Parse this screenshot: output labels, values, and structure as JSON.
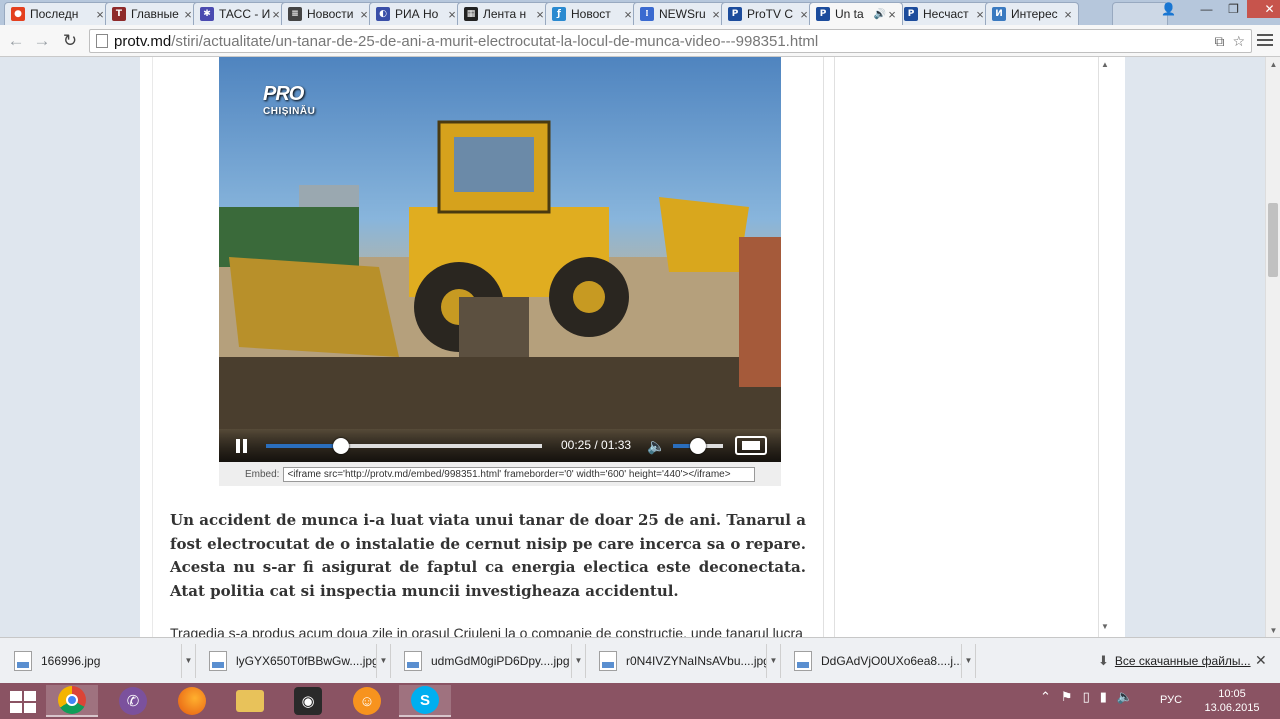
{
  "tabs": [
    {
      "title": "Последн",
      "favicon": "opera-icon",
      "color": "#e4401f",
      "glyph": "●"
    },
    {
      "title": "Главные",
      "favicon": "t-icon",
      "color": "#8e2a2a",
      "glyph": "T"
    },
    {
      "title": "ТАСС - И",
      "favicon": "tass-icon",
      "color": "#4a4ab0",
      "glyph": "✱"
    },
    {
      "title": "Новости",
      "favicon": "document-icon",
      "color": "#444444",
      "glyph": "≡"
    },
    {
      "title": "РИА Но",
      "favicon": "ria-icon",
      "color": "#3a4fa8",
      "glyph": "◐"
    },
    {
      "title": "Лента н",
      "favicon": "lenta-icon",
      "color": "#222222",
      "glyph": "▦"
    },
    {
      "title": "Новост",
      "favicon": "fontanka-icon",
      "color": "#2a8ad0",
      "glyph": "ƒ"
    },
    {
      "title": "NEWSru",
      "favicon": "newsru-icon",
      "color": "#3a6ad0",
      "glyph": "⁞"
    },
    {
      "title": "ProTV C",
      "favicon": "protv-icon",
      "color": "#1c4c9c",
      "glyph": "P"
    },
    {
      "title": "Un ta",
      "favicon": "protv-icon",
      "color": "#1c4c9c",
      "glyph": "P"
    },
    {
      "title": "Несчаст",
      "favicon": "protv-icon",
      "color": "#1c4c9c",
      "glyph": "P"
    },
    {
      "title": "Интерес",
      "favicon": "i-icon",
      "color": "#3a7ac0",
      "glyph": "И"
    }
  ],
  "address_bar": {
    "domain": "protv.md",
    "path": "/stiri/actualitate/un-tanar-de-25-de-ani-a-murit-electrocutat-la-locul-de-munca-video---998351.html"
  },
  "video": {
    "logo_top": "PRO",
    "logo_bottom": "CHIȘINĂU",
    "time_display": "00:25 / 01:33",
    "progress_fraction": 0.27,
    "volume_fraction": 0.5
  },
  "embed": {
    "label": "Embed:",
    "code": "<iframe src='http://protv.md/embed/998351.html' frameborder='0' width='600' height='440'></iframe>"
  },
  "article": {
    "lead": "Un accident de munca i-a luat viata unui tanar de doar 25 de ani. Tanarul a fost electrocutat de o instalatie de cernut nisip pe care incerca sa o repare. Acesta nu s-ar fi asigurat de faptul ca energia electica este deconectata. Atat politia cat si inspectia muncii investigheaza accidentul.",
    "body": "Tragedia s-a produs acum doua zile in orasul Criuleni la o companie de constructie, unde tanarul lucra"
  },
  "downloads": {
    "items": [
      {
        "name": "166996.jpg"
      },
      {
        "name": "lyGYX650T0fBBwGw....jpg"
      },
      {
        "name": "udmGdM0giPD6Dpy....jpg"
      },
      {
        "name": "r0N4IVZYNaINsAVbu....jpg"
      },
      {
        "name": "DdGAdVjO0UXo6ea8....j..."
      }
    ],
    "show_all": "Все скачанные файлы..."
  },
  "taskbar": {
    "lang": "РУС",
    "time": "10:05",
    "date": "13.06.2015"
  }
}
